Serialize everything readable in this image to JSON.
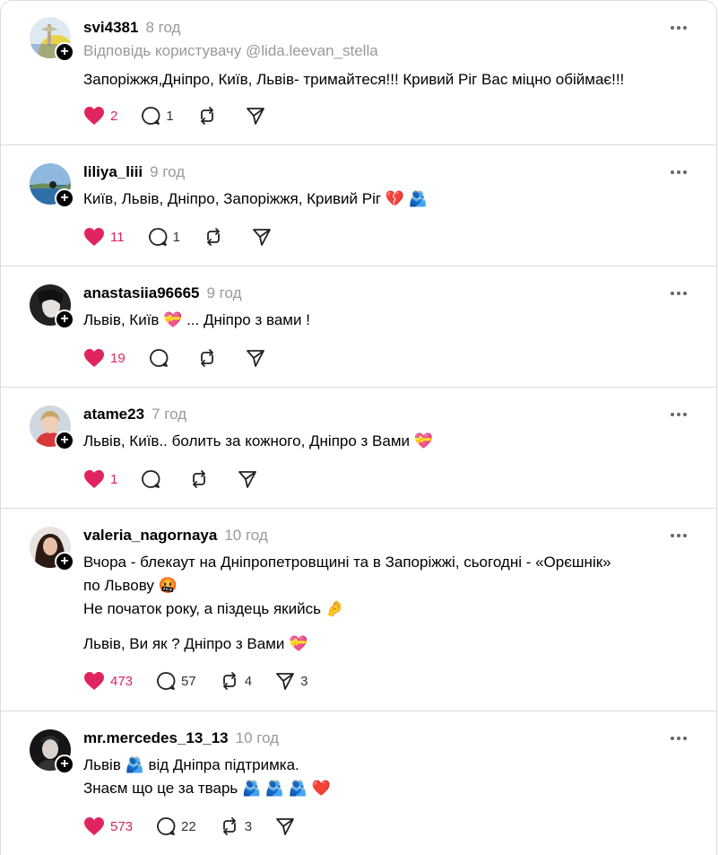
{
  "posts": [
    {
      "username": "svi4381",
      "time": "8 год",
      "reply_to": "Відповідь користувачу @lida.leevan_stella",
      "text": "Запоріжжя,Дніпро, Київ, Львів- тримайтеся!!! Кривий Ріг Вас міцно обіймає!!!",
      "likes": "2",
      "replies": "1",
      "reposts": "",
      "shares": ""
    },
    {
      "username": "liliya_liii",
      "time": "9 год",
      "text": "Київ, Львів, Дніпро, Запоріжжя, Кривий Ріг 💔 🫂",
      "likes": "11",
      "replies": "1",
      "reposts": "",
      "shares": ""
    },
    {
      "username": "anastasiia96665",
      "time": "9 год",
      "text": "Львів, Київ 💝 ... Дніпро з вами !",
      "likes": "19",
      "replies": "",
      "reposts": "",
      "shares": ""
    },
    {
      "username": "atame23",
      "time": "7 год",
      "text": "Львів, Київ.. болить за кожного, Дніпро з Вами 💝",
      "likes": "1",
      "replies": "",
      "reposts": "",
      "shares": ""
    },
    {
      "username": "valeria_nagornaya",
      "time": "10 год",
      "text_lines": [
        "Вчора - блекаут на Дніпропетровщині та в Запоріжжі, сьогодні - «Орєшнік»",
        "по Львову 🤬",
        "Не початок року, а піздець якийсь 🤌",
        "Львів, Ви як ? Дніпро з Вами 💝"
      ],
      "likes": "473",
      "replies": "57",
      "reposts": "4",
      "shares": "3"
    },
    {
      "username": "mr.mercedes_13_13",
      "time": "10 год",
      "text_lines": [
        "Львів 🫂 від Дніпра підтримка.",
        "Знаєм що це за тварь 🫂 🫂 🫂 ❤️"
      ],
      "likes": "573",
      "replies": "22",
      "reposts": "3",
      "shares": ""
    }
  ],
  "colors": {
    "like": "#e0245e",
    "muted": "#999999",
    "divider": "#dcdcdc"
  },
  "icons": [
    "heart-icon",
    "comment-icon",
    "repost-icon",
    "share-icon",
    "more-icon",
    "follow-plus-icon"
  ]
}
